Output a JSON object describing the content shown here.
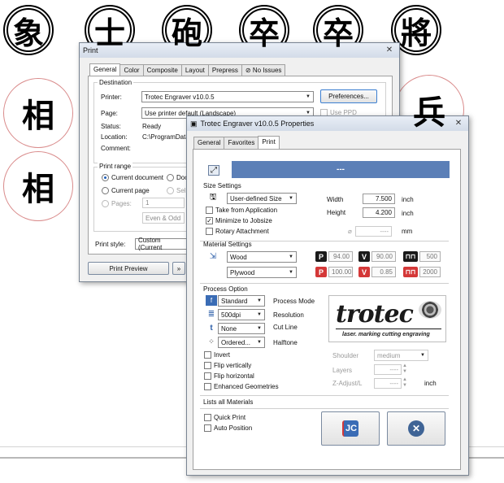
{
  "pieces": [
    {
      "char": "象",
      "style": "black"
    },
    {
      "char": "士",
      "style": "black"
    },
    {
      "char": "砲",
      "style": "black"
    },
    {
      "char": "卒",
      "style": "black"
    },
    {
      "char": "卒",
      "style": "black"
    },
    {
      "char": "將",
      "style": "black"
    },
    {
      "char": "相",
      "style": "red"
    },
    {
      "char": "兵",
      "style": "red"
    },
    {
      "char": "相",
      "style": "red"
    }
  ],
  "print_dialog": {
    "title": "Print",
    "tabs": [
      "General",
      "Color",
      "Composite",
      "Layout",
      "Prepress",
      "No Issues"
    ],
    "destination_label": "Destination",
    "printer_label": "Printer:",
    "printer_value": "Trotec Engraver v10.0.5",
    "preferences_button": "Preferences...",
    "page_label": "Page:",
    "page_value": "Use printer default (Landscape)",
    "use_ppd": "Use PPD",
    "status_label": "Status:",
    "status_value": "Ready",
    "location_label": "Location:",
    "location_value": "C:\\ProgramData",
    "comment_label": "Comment:",
    "print_range_label": "Print range",
    "current_document": "Current document",
    "documents_partial": "Doc",
    "current_page": "Current page",
    "selection_partial": "Sele",
    "pages_label": "Pages:",
    "pages_value": "1",
    "even_odd": "Even & Odd",
    "print_style_label": "Print style:",
    "print_style_value": "Custom (Current",
    "print_preview_button": "Print Preview"
  },
  "properties_dialog": {
    "title": "Trotec Engraver v10.0.5 Properties",
    "tabs": [
      "General",
      "Favorites",
      "Print"
    ],
    "job_name": "---",
    "size_settings_label": "Size Settings",
    "size_mode": "User-defined Size",
    "take_from_application": "Take from Application",
    "minimize_to_jobsize": "Minimize to Jobsize",
    "rotary_attachment": "Rotary Attachment",
    "width_label": "Width",
    "width_value": "7.500",
    "height_label": "Height",
    "height_value": "4.200",
    "unit_inch": "inch",
    "diameter_value": "----",
    "unit_mm": "mm",
    "material_settings_label": "Material Settings",
    "material_group": "Wood",
    "material_name": "Plywood",
    "power_values": [
      "94.00",
      "100.00"
    ],
    "velocity_values": [
      "90.00",
      "0.85"
    ],
    "freq_values": [
      "500",
      "2000"
    ],
    "process_option_label": "Process Option",
    "process_mode_value": "Standard",
    "process_mode_label": "Process Mode",
    "resolution_value": "500dpi",
    "resolution_label": "Resolution",
    "cutline_value": "None",
    "cutline_label": "Cut Line",
    "halftone_value": "Ordered...",
    "halftone_label": "Halftone",
    "invert": "Invert",
    "flip_vertically": "Flip vertically",
    "flip_horizontal": "Flip horizontal",
    "enhanced_geometries": "Enhanced Geometries",
    "logo_text": "trotec",
    "logo_tagline": "laser. marking cutting engraving",
    "shoulder_label": "Shoulder",
    "shoulder_value": "medium",
    "layers_label": "Layers",
    "layers_value": "----",
    "zadjust_label": "Z-Adjust/L",
    "zadjust_value": "----",
    "zadjust_unit": "inch",
    "lists_all_materials": "Lists all Materials",
    "quick_print": "Quick Print",
    "auto_position": "Auto Position"
  },
  "colors": {
    "job_bar": "#5b7fb7",
    "power_badge": "#1a1a1a",
    "power_badge_red": "#d43838",
    "velocity_badge": "#1a1a1a",
    "velocity_badge_red": "#d43838",
    "freq_icon": "#1a1a1a",
    "freq_icon_red": "#d43838"
  }
}
